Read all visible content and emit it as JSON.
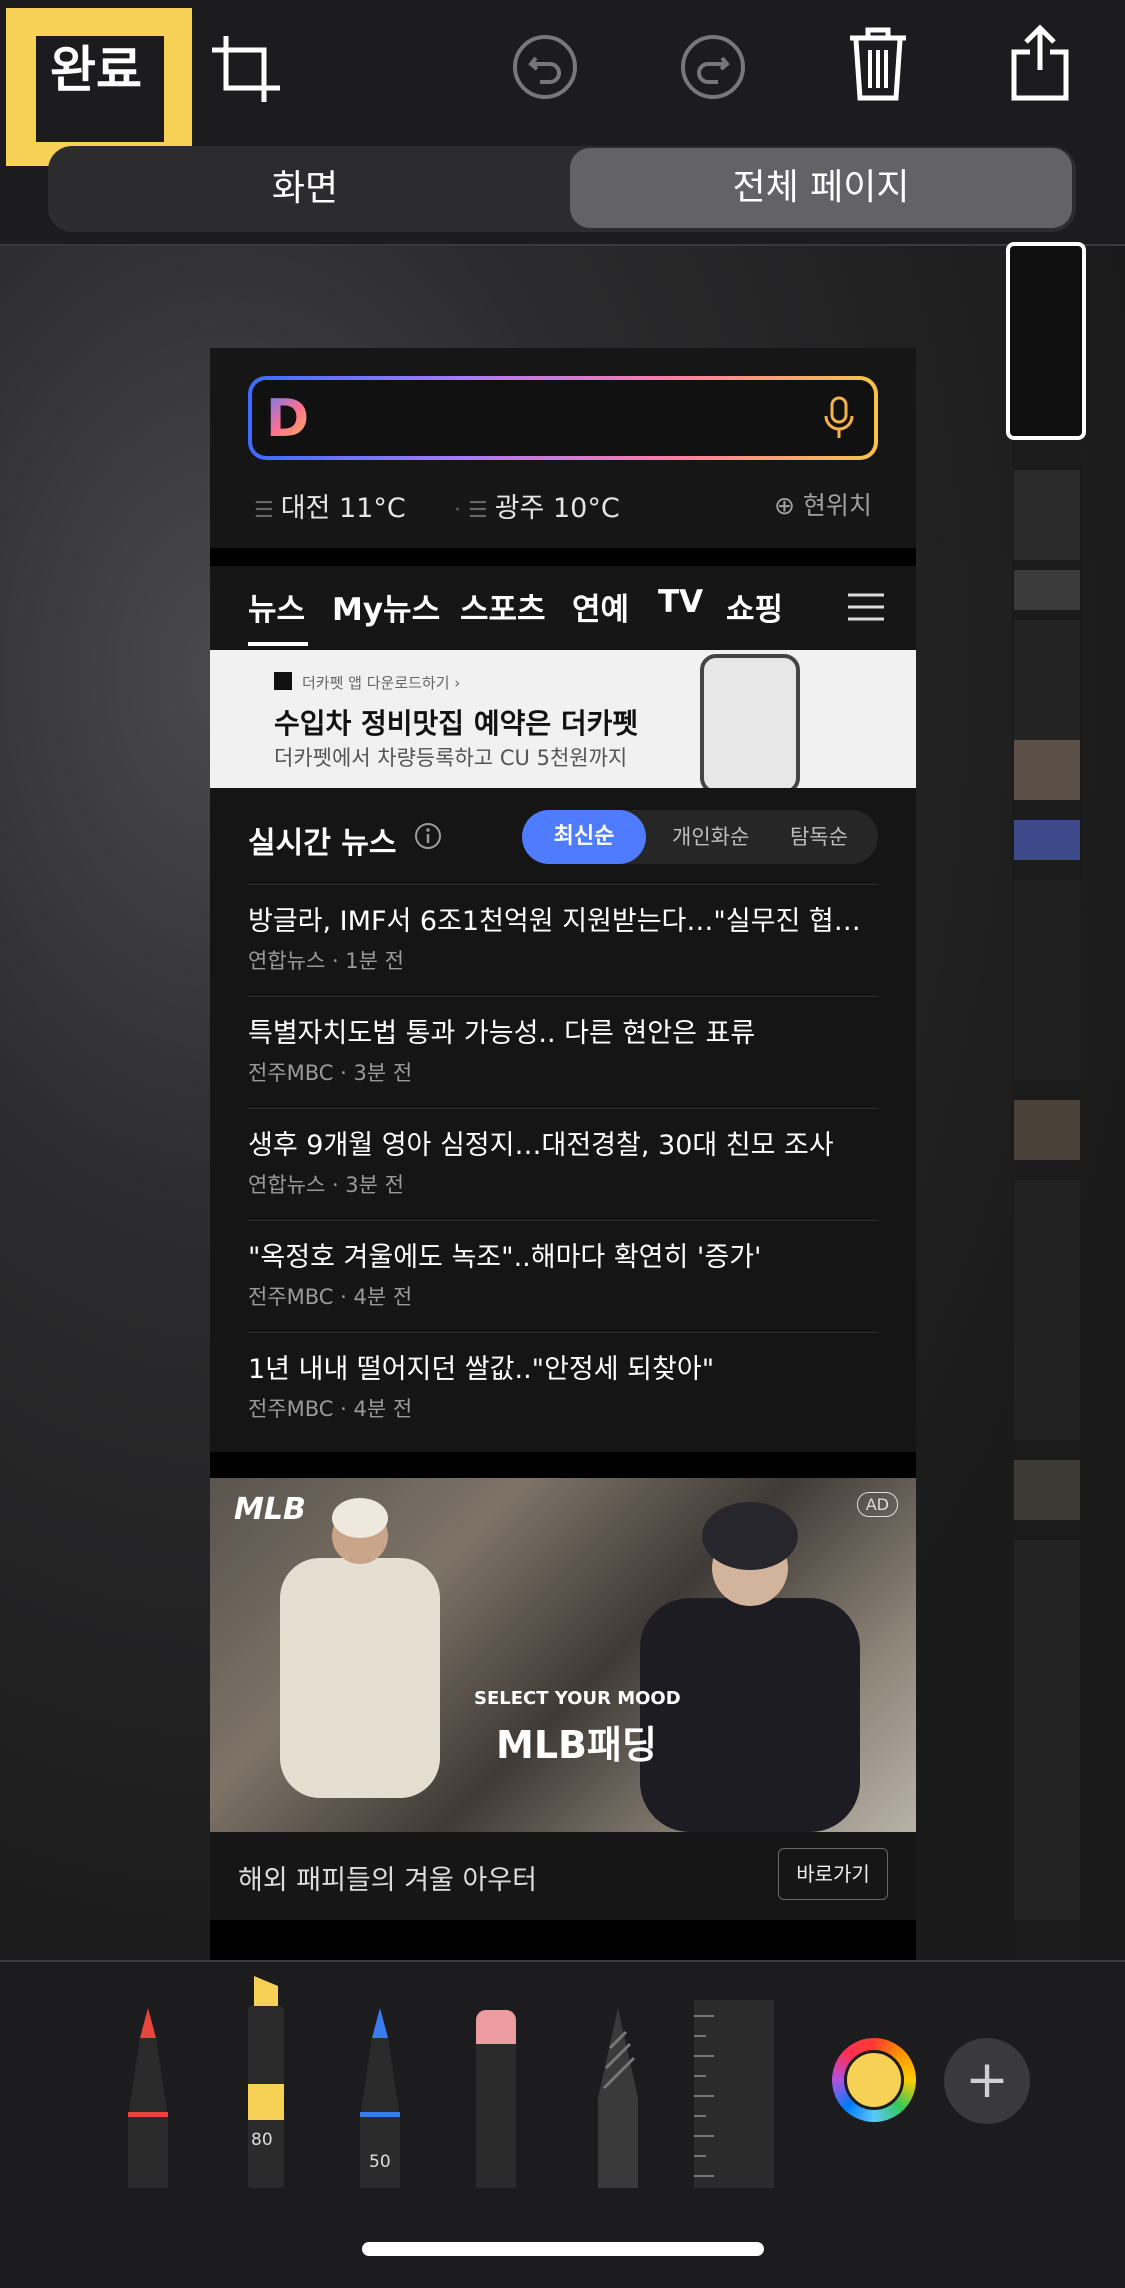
{
  "toolbar": {
    "done_label": "완료",
    "icons": [
      "crop-icon",
      "undo-icon",
      "redo-icon",
      "trash-icon",
      "share-icon"
    ]
  },
  "segmented": {
    "left": "화면",
    "right": "전체 페이지",
    "selected": "right"
  },
  "page": {
    "weather": [
      {
        "city": "대전",
        "temp": "11°C"
      },
      {
        "city": "광주",
        "temp": "10°C"
      }
    ],
    "location_label": "현위치",
    "nav_tabs": [
      "뉴스",
      "My뉴스",
      "스포츠",
      "연예",
      "TV",
      "쇼핑"
    ],
    "ad_banner": {
      "small": "더카펫 앱 다운로드하기 ›",
      "title": "수입차 정비맛집 예약은 더카펫",
      "sub": "더카펫에서 차량등록하고 CU 5천원까지"
    },
    "news": {
      "title": "실시간 뉴스",
      "sort_options": [
        "최신순",
        "개인화순",
        "탐독순"
      ],
      "items": [
        {
          "headline": "방글라, IMF서 6조1천억원 지원받는다…\"실무진 협…",
          "source": "연합뉴스 · 1분 전"
        },
        {
          "headline": "특별자치도법 통과 가능성.. 다른 현안은 표류",
          "source": "전주MBC · 3분 전"
        },
        {
          "headline": "생후 9개월 영아 심정지…대전경찰, 30대 친모 조사",
          "source": "연합뉴스 · 3분 전"
        },
        {
          "headline": "\"옥정호 겨울에도 녹조\"..해마다 확연히 '증가'",
          "source": "전주MBC · 4분 전"
        },
        {
          "headline": "1년 내내 떨어지던 쌀값..\"안정세 되찾아\"",
          "source": "전주MBC · 4분 전"
        }
      ]
    },
    "mlb_ad": {
      "logo": "MLB",
      "ad_tag": "AD",
      "select": "SELECT YOUR MOOD",
      "main": "MLB패딩",
      "caption": "해외 패피들의 겨울 아우터",
      "button": "바로가기"
    }
  },
  "tools": {
    "marker_label": "80",
    "pen_label": "50",
    "current_color": "#f7d155",
    "accent": "#f7d155"
  }
}
